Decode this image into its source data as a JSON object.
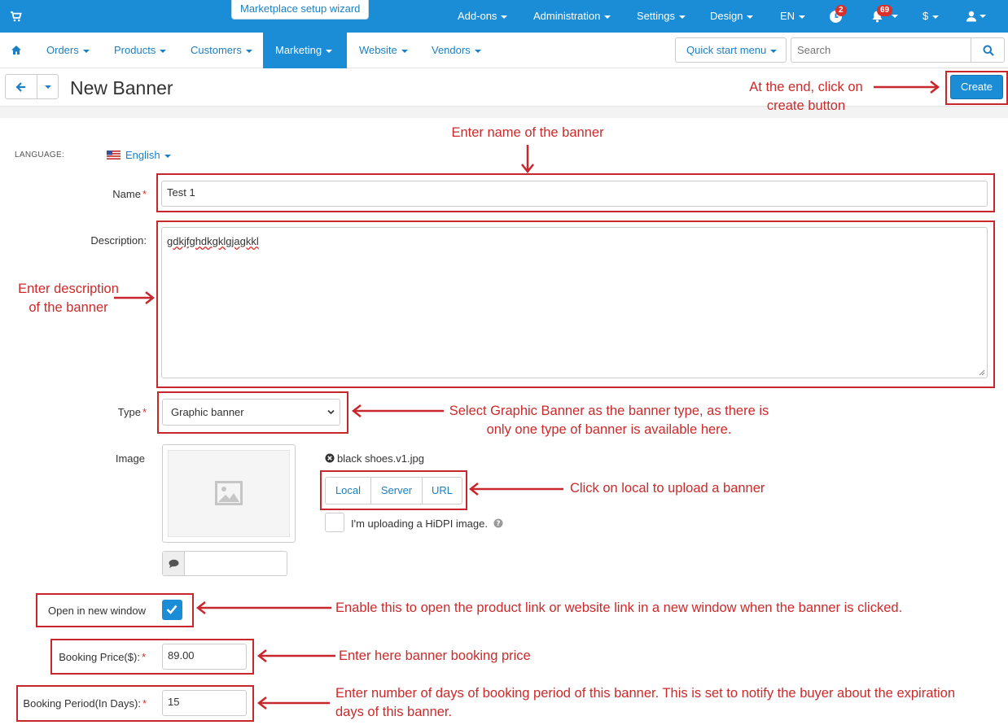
{
  "topbar": {
    "wizard_label": "Marketplace setup wizard",
    "menu": [
      "Add-ons",
      "Administration",
      "Settings",
      "Design",
      "EN"
    ],
    "updates_badge": "2",
    "notifications_badge": "69",
    "currency": "$"
  },
  "nav": {
    "items": [
      "Orders",
      "Products",
      "Customers",
      "Marketing",
      "Website",
      "Vendors"
    ],
    "active": "Marketing",
    "quick_start": "Quick start menu",
    "search_placeholder": "Search"
  },
  "page": {
    "title": "New Banner",
    "create_label": "Create"
  },
  "form": {
    "language_label": "LANGUAGE:",
    "language_value": "English",
    "name_label": "Name",
    "name_value": "Test 1",
    "description_label": "Description:",
    "description_value": "gdkjfghdkgklgjagkkl",
    "type_label": "Type",
    "type_value": "Graphic banner",
    "image_label": "Image",
    "image_file": "black shoes.v1.jpg",
    "upload_sources": [
      "Local",
      "Server",
      "URL"
    ],
    "hidpi_label": "I'm uploading a HiDPI image.",
    "open_new_window_label": "Open in new window",
    "open_new_window_checked": true,
    "booking_price_label": "Booking Price($):",
    "booking_price_value": "89.00",
    "booking_period_label": "Booking Period(In Days):",
    "booking_period_value": "15"
  },
  "annotations": {
    "create": [
      "At the end, click on",
      "create button"
    ],
    "name": "Enter name of the banner",
    "description": [
      "Enter description",
      "of the banner"
    ],
    "type": [
      "Select Graphic Banner as the banner type, as there is",
      "only one type of banner is available here."
    ],
    "local": "Click on local to upload a banner",
    "window": "Enable this to open the product link or website link in a new window when the banner is clicked.",
    "price": "Enter here banner booking price",
    "period": [
      "Enter number of days of booking period of this banner. This is set to notify the buyer about the expiration",
      "days of this banner."
    ]
  },
  "colors": {
    "primary": "#1b8cd6",
    "annotation_red": "#c8272d",
    "badge_red": "#d9302c"
  }
}
